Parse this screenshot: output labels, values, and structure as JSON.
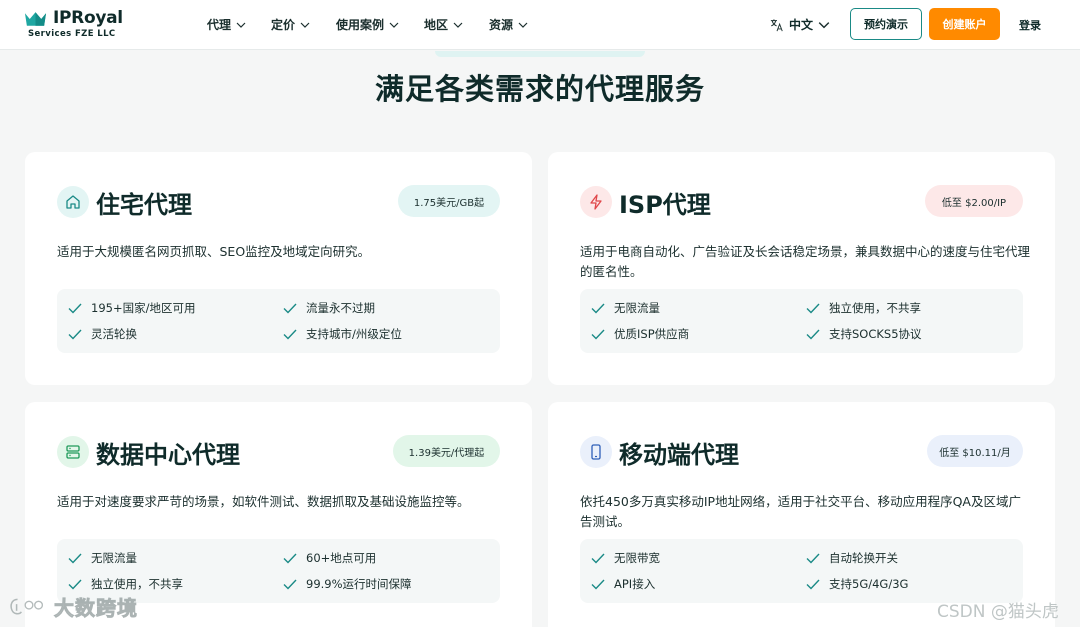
{
  "header": {
    "logo": {
      "brand": "IPRoyal",
      "sub": "Services FZE LLC"
    },
    "nav": [
      {
        "label": "代理"
      },
      {
        "label": "定价"
      },
      {
        "label": "使用案例"
      },
      {
        "label": "地区"
      },
      {
        "label": "资源"
      }
    ],
    "language": "中文",
    "demo_label": "预约演示",
    "create_label": "创建账户",
    "login_label": "登录"
  },
  "title": "满足各类需求的代理服务",
  "cards": [
    {
      "title": "住宅代理",
      "price": "1.75美元/GB起",
      "icon": "home-icon",
      "desc": "适用于大规模匿名网页抓取、SEO监控及地域定向研究。",
      "features": [
        "195+国家/地区可用",
        "流量永不过期",
        "灵活轮换",
        "支持城市/州级定位"
      ]
    },
    {
      "title": "ISP代理",
      "price": "低至 $2.00/IP",
      "icon": "lightning-icon",
      "desc": "适用于电商自动化、广告验证及长会话稳定场景，兼具数据中心的速度与住宅代理的匿名性。",
      "features": [
        "无限流量",
        "独立使用，不共享",
        "优质ISP供应商",
        "支持SOCKS5协议"
      ]
    },
    {
      "title": "数据中心代理",
      "price": "1.39美元/代理起",
      "icon": "server-icon",
      "desc": "适用于对速度要求严苛的场景，如软件测试、数据抓取及基础设施监控等。",
      "features": [
        "无限流量",
        "60+地点可用",
        "独立使用，不共享",
        "99.9%运行时间保障"
      ]
    },
    {
      "title": "移动端代理",
      "price": "低至 $10.11/月",
      "icon": "mobile-icon",
      "desc": "依托450多万真实移动IP地址网络，适用于社交平台、移动应用程序QA及区域广告测试。",
      "features": [
        "无限带宽",
        "自动轮换开关",
        "API接入",
        "支持5G/4G/3G"
      ]
    }
  ],
  "watermarks": {
    "left": "大数跨境",
    "right": "CSDN @猫头虎"
  },
  "colors": {
    "accent": "#1a8a86",
    "orange": "#ff8a00",
    "check": "#1a8a86",
    "residential_bg": "#e3f5f4",
    "isp_bg": "#fde8e8",
    "datacenter_bg": "#e2f6e9",
    "mobile_bg": "#eaf0fb"
  }
}
